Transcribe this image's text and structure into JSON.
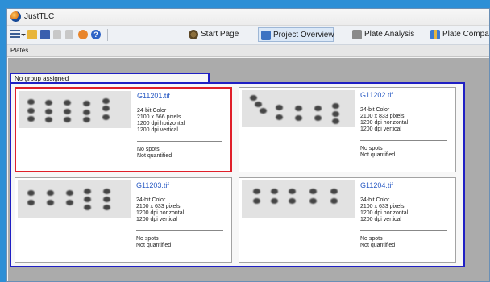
{
  "window": {
    "title": "JustTLC"
  },
  "toolbar": {
    "buttons": [
      {
        "label": "Start Page"
      },
      {
        "label": "Project Overview"
      },
      {
        "label": "Plate Analysis"
      },
      {
        "label": "Plate Compariso"
      }
    ]
  },
  "panel": {
    "title": "Plates"
  },
  "group": {
    "label": "No group assigned"
  },
  "plates": [
    {
      "filename": "G11201.tif",
      "color": "24-bit Color",
      "size": "2100 x 666 pixels",
      "dpi_h": "1200 dpi horizontal",
      "dpi_v": "1200 dpi vertical",
      "spots": "No spots",
      "quant": "Not quantified",
      "selected": true
    },
    {
      "filename": "G11202.tif",
      "color": "24-bit Color",
      "size": "2100 x 833 pixels",
      "dpi_h": "1200 dpi horizontal",
      "dpi_v": "1200 dpi vertical",
      "spots": "No spots",
      "quant": "Not quantified",
      "selected": false
    },
    {
      "filename": "G11203.tif",
      "color": "24-bit Color",
      "size": "2100 x 633 pixels",
      "dpi_h": "1200 dpi horizontal",
      "dpi_v": "1200 dpi vertical",
      "spots": "No spots",
      "quant": "Not quantified",
      "selected": false
    },
    {
      "filename": "G11204.tif",
      "color": "24-bit Color",
      "size": "2100 x 633 pixels",
      "dpi_h": "1200 dpi horizontal",
      "dpi_v": "1200 dpi vertical",
      "spots": "No spots",
      "quant": "Not quantified",
      "selected": false
    }
  ],
  "colors": {
    "selection": "#e0202a",
    "group_border": "#2020c4",
    "filename": "#2b5cc4",
    "desktop": "#2d8fd6"
  },
  "icons": [
    "app-icon",
    "list-icon",
    "folder-icon",
    "save-icon",
    "undo-icon",
    "redo-icon",
    "run-icon",
    "help-icon",
    "start-page-icon",
    "project-overview-icon",
    "plate-analysis-icon",
    "plate-comparison-icon"
  ]
}
